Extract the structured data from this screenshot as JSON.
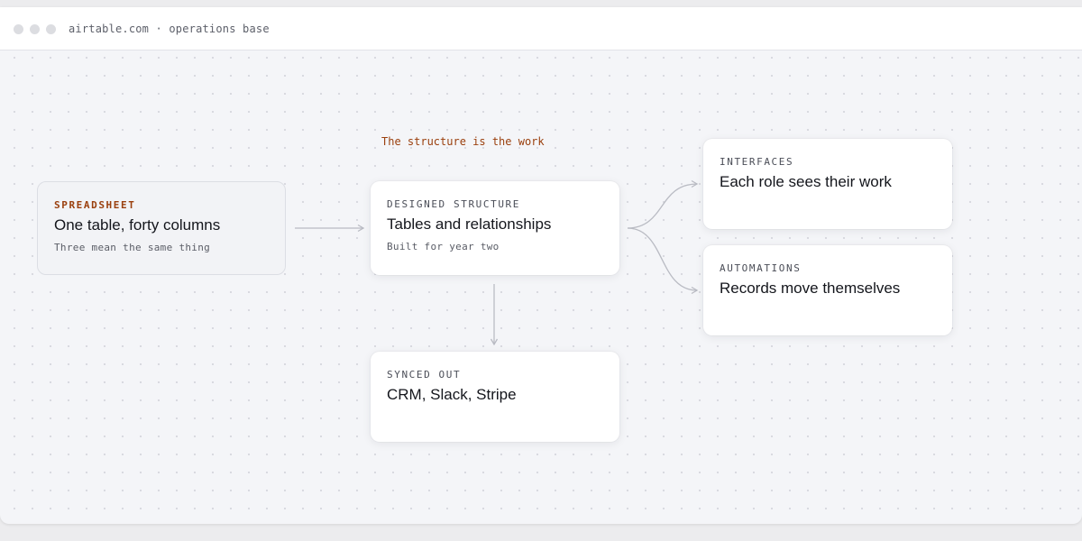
{
  "window": {
    "url": "airtable.com · operations base"
  },
  "diagram": {
    "caption": "The structure is the work",
    "nodes": {
      "spreadsheet": {
        "eyebrow": "SPREADSHEET",
        "heading": "One table, forty columns",
        "sub": "Three mean the same thing"
      },
      "designed": {
        "eyebrow": "DESIGNED STRUCTURE",
        "heading": "Tables and relationships",
        "sub": "Built for year two"
      },
      "synced": {
        "eyebrow": "SYNCED OUT",
        "heading": "CRM, Slack, Stripe"
      },
      "interfaces": {
        "eyebrow": "INTERFACES",
        "heading": "Each role sees their work"
      },
      "automations": {
        "eyebrow": "AUTOMATIONS",
        "heading": "Records move themselves"
      }
    }
  },
  "colors": {
    "accent": "#9a3f0d",
    "connector": "#b9bbc3",
    "canvas": "#f4f5f8"
  }
}
